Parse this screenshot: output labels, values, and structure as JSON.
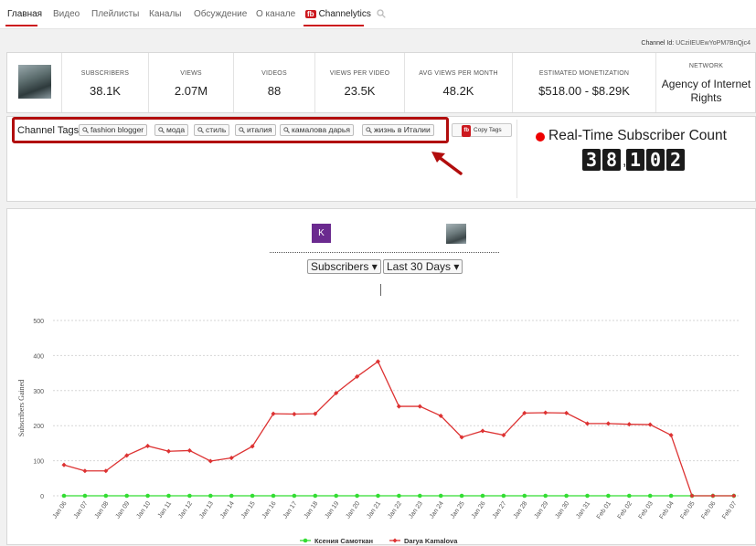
{
  "tabs": [
    {
      "label": "Главная",
      "active": true
    },
    {
      "label": "Видео"
    },
    {
      "label": "Плейлисты"
    },
    {
      "label": "Каналы"
    },
    {
      "label": "Обсуждение"
    },
    {
      "label": "О канале"
    },
    {
      "label": "Channelytics",
      "badge": "fb"
    }
  ],
  "channel_id": {
    "label": "Channel Id:",
    "value": "UCziIEUEwYoPM7BnQjc4"
  },
  "stats": [
    {
      "label": "SUBSCRIBERS",
      "value": "38.1K"
    },
    {
      "label": "VIEWS",
      "value": "2.07M"
    },
    {
      "label": "VIDEOS",
      "value": "88"
    },
    {
      "label": "VIEWS PER VIDEO",
      "value": "23.5K"
    },
    {
      "label": "AVG VIEWS PER MONTH",
      "value": "48.2K"
    },
    {
      "label": "ESTIMATED MONETIZATION",
      "value": "$518.00 - $8.29K"
    },
    {
      "label": "NETWORK",
      "value": "Agency of Internet Rights"
    }
  ],
  "tags": {
    "title": "Channel Tags",
    "items": [
      "fashion blogger",
      "мода",
      "стиль",
      "италия",
      "камалова дарья",
      "жизнь в Италии"
    ],
    "copy_label": "Copy Tags",
    "copy_badge": "fb"
  },
  "realtime": {
    "title": "Real-Time Subscriber Count",
    "digits": [
      "3",
      "8",
      ",",
      "1",
      "0",
      "2"
    ]
  },
  "compare": {
    "k_badge": "K"
  },
  "filters": {
    "metric": "Subscribers ▾",
    "range": "Last 30 Days ▾"
  },
  "colors": {
    "accent": "#cc181e",
    "series_a": "#33dd33",
    "series_b": "#dd3333"
  },
  "chart_data": {
    "type": "line",
    "ylabel": "Subscribers Gained",
    "ylim": [
      0,
      500
    ],
    "yticks": [
      0,
      100,
      200,
      300,
      400,
      500
    ],
    "categories": [
      "Jan 06",
      "Jan 07",
      "Jan 08",
      "Jan 09",
      "Jan 10",
      "Jan 11",
      "Jan 12",
      "Jan 13",
      "Jan 14",
      "Jan 15",
      "Jan 16",
      "Jan 17",
      "Jan 18",
      "Jan 19",
      "Jan 20",
      "Jan 21",
      "Jan 22",
      "Jan 23",
      "Jan 24",
      "Jan 25",
      "Jan 26",
      "Jan 27",
      "Jan 28",
      "Jan 29",
      "Jan 30",
      "Jan 31",
      "Feb 01",
      "Feb 02",
      "Feb 03",
      "Feb 04",
      "Feb 05",
      "Feb 06",
      "Feb 07"
    ],
    "series": [
      {
        "name": "Ксения Самоткан",
        "values": [
          0,
          0,
          0,
          0,
          0,
          0,
          0,
          0,
          0,
          0,
          0,
          0,
          0,
          0,
          0,
          0,
          0,
          0,
          0,
          0,
          0,
          0,
          0,
          0,
          0,
          0,
          0,
          0,
          0,
          0,
          0,
          0,
          0
        ]
      },
      {
        "name": "Darya Kamalova",
        "values": [
          88,
          71,
          71,
          115,
          142,
          127,
          129,
          99,
          108,
          141,
          234,
          233,
          234,
          293,
          340,
          383,
          255,
          255,
          228,
          167,
          185,
          173,
          236,
          237,
          236,
          206,
          206,
          204,
          203,
          173,
          0,
          0,
          0
        ]
      }
    ]
  }
}
